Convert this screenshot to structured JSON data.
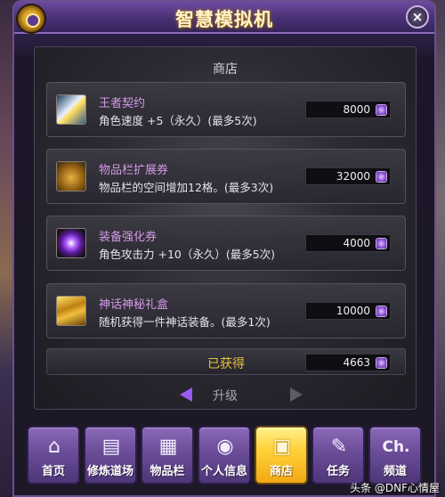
{
  "window": {
    "title": "智慧模拟机",
    "close_glyph": "×"
  },
  "shop": {
    "title": "商店",
    "items": [
      {
        "name": "王者契约",
        "desc": "角色速度 +5（永久）(最多5次)",
        "price": "8000",
        "icon": "contract-icon"
      },
      {
        "name": "物品栏扩展券",
        "desc": "物品栏的空间增加12格。(最多3次)",
        "price": "32000",
        "icon": "bag-icon"
      },
      {
        "name": "装备强化券",
        "desc": "角色攻击力 +10（永久）(最多5次)",
        "price": "4000",
        "icon": "enhance-icon"
      },
      {
        "name": "神话神秘礼盒",
        "desc": "随机获得一件神话装备。(最多1次)",
        "price": "10000",
        "icon": "gift-box-icon"
      }
    ],
    "obtained": {
      "label": "已获得",
      "value": "4663"
    },
    "upgrade_label": "升级"
  },
  "tabs": [
    {
      "label": "首页",
      "icon": "home-icon",
      "glyph": "⌂",
      "active": false
    },
    {
      "label": "修炼道场",
      "icon": "dojo-icon",
      "glyph": "▤",
      "active": false
    },
    {
      "label": "物品栏",
      "icon": "inventory-icon",
      "glyph": "▦",
      "active": false
    },
    {
      "label": "个人信息",
      "icon": "profile-icon",
      "glyph": "◉",
      "active": false
    },
    {
      "label": "商店",
      "icon": "shop-icon",
      "glyph": "▣",
      "active": true
    },
    {
      "label": "任务",
      "icon": "quest-scroll-icon",
      "glyph": "✎",
      "active": false
    },
    {
      "label": "频道",
      "icon": "channel-icon",
      "glyph": "Ch.",
      "active": false
    }
  ],
  "watermark": "头条 @DNF心情屋",
  "colors": {
    "item_name": "#d29ae8",
    "obtained_label": "#e8c238",
    "active_tab": "#ffd23a"
  }
}
